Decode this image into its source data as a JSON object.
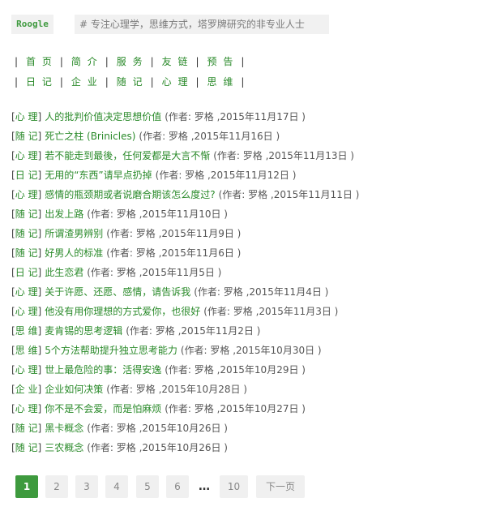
{
  "header": {
    "logo": "Roogle",
    "tagline": "# 专注心理学，思维方式，塔罗牌研究的非专业人士"
  },
  "nav": {
    "row1": [
      "首 页",
      "简 介",
      "服 务",
      "友 链",
      "预 告"
    ],
    "row2": [
      "日 记",
      "企 业",
      "随 记",
      "心 理",
      "思 维"
    ],
    "separator": "|"
  },
  "posts": [
    {
      "category": "心 理",
      "title": "人的批判价值决定思想价值",
      "meta": "(作者: 罗格 ,2015年11月17日 )"
    },
    {
      "category": "随 记",
      "title": "死亡之柱 (Brinicles)",
      "meta": "(作者: 罗格 ,2015年11月16日 )"
    },
    {
      "category": "心 理",
      "title": "若不能走到最後，任何爱都是大言不惭",
      "meta": "(作者: 罗格 ,2015年11月13日 )"
    },
    {
      "category": "日 记",
      "title": "无用的“东西”请早点扔掉",
      "meta": "(作者: 罗格 ,2015年11月12日 )"
    },
    {
      "category": "心 理",
      "title": "感情的瓶颈期或者说磨合期该怎么度过?",
      "meta": "(作者: 罗格 ,2015年11月11日 )"
    },
    {
      "category": "随 记",
      "title": "出发上路",
      "meta": "(作者: 罗格 ,2015年11月10日 )"
    },
    {
      "category": "随 记",
      "title": "所谓渣男辨别",
      "meta": "(作者: 罗格 ,2015年11月9日 )"
    },
    {
      "category": "随 记",
      "title": "好男人的标准",
      "meta": "(作者: 罗格 ,2015年11月6日 )"
    },
    {
      "category": "日 记",
      "title": "此生恋君",
      "meta": "(作者: 罗格 ,2015年11月5日 )"
    },
    {
      "category": "心 理",
      "title": "关于许愿、还愿、感情，请告诉我",
      "meta": "(作者: 罗格 ,2015年11月4日 )"
    },
    {
      "category": "心 理",
      "title": "他没有用你理想的方式爱你，也很好",
      "meta": "(作者: 罗格 ,2015年11月3日 )"
    },
    {
      "category": "思 维",
      "title": "麦肯锡的思考逻辑",
      "meta": "(作者: 罗格 ,2015年11月2日 )"
    },
    {
      "category": "思 维",
      "title": "5个方法帮助提升独立思考能力",
      "meta": "(作者: 罗格 ,2015年10月30日 )"
    },
    {
      "category": "心 理",
      "title": "世上最危险的事：活得安逸",
      "meta": "(作者: 罗格 ,2015年10月29日 )"
    },
    {
      "category": "企 业",
      "title": "企业如何决策",
      "meta": "(作者: 罗格 ,2015年10月28日 )"
    },
    {
      "category": "心 理",
      "title": "你不是不会爱，而是怕麻烦",
      "meta": "(作者: 罗格 ,2015年10月27日 )"
    },
    {
      "category": "随 记",
      "title": "黑卡概念",
      "meta": "(作者: 罗格 ,2015年10月26日 )"
    },
    {
      "category": "随 记",
      "title": "三农概念",
      "meta": "(作者: 罗格 ,2015年10月26日 )"
    }
  ],
  "pagination": {
    "current": "1",
    "pages": [
      "1",
      "2",
      "3",
      "4",
      "5",
      "6",
      "…",
      "10",
      "下一页"
    ]
  },
  "colors": {
    "accent": "#2a8a2a",
    "active_page": "#3e9a3e",
    "chip_bg": "#f1f1f1"
  }
}
